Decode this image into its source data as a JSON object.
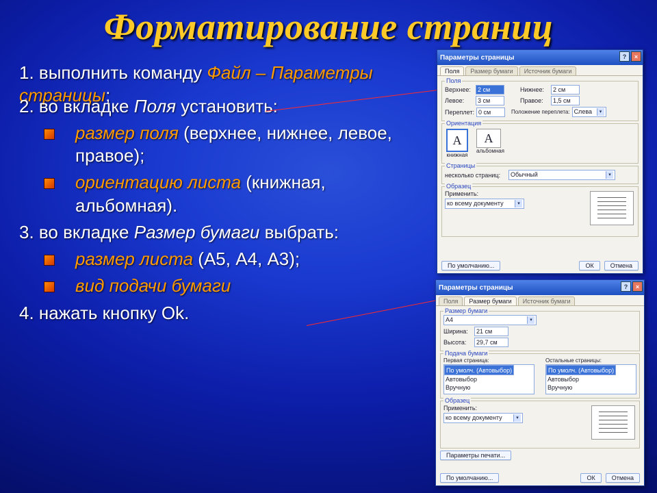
{
  "title": "Форматирование страниц",
  "steps": {
    "s1_a": "1. выполнить команду ",
    "s1_b": "Файл – Параметры страницы",
    "s1_c": ";",
    "s2_a": "2. во вкладке ",
    "s2_b": "Поля",
    "s2_c": " установить:",
    "b1_a": "размер поля",
    "b1_b": " (верхнее, нижнее, левое, правое);",
    "b2_a": "ориентацию листа",
    "b2_b": " (книжная, альбомная).",
    "s3_a": "3. во вкладке ",
    "s3_b": "Размер бумаги",
    "s3_c": " выбрать:",
    "b3_a": "размер листа",
    "b3_b": " (А5, А4, А3);",
    "b4_a": "вид подачи бумаги",
    "s4": "4. нажать  кнопку  Ok."
  },
  "dialog1": {
    "title": "Параметры страницы",
    "tabs": [
      "Поля",
      "Размер бумаги",
      "Источник бумаги"
    ],
    "grp_margins": "Поля",
    "top_l": "Верхнее:",
    "top_v": "2 см",
    "bot_l": "Нижнее:",
    "bot_v": "2 см",
    "left_l": "Левое:",
    "left_v": "3 см",
    "right_l": "Правое:",
    "right_v": "1,5 см",
    "gut_l": "Переплет:",
    "gut_v": "0 см",
    "gutpos_l": "Положение переплета:",
    "gutpos_v": "Слева",
    "grp_orient": "Ориентация",
    "orient_port": "книжная",
    "orient_land": "альбомная",
    "grp_pages": "Страницы",
    "pages_l": "несколько страниц:",
    "pages_v": "Обычный",
    "grp_sample": "Образец",
    "apply_l": "Применить:",
    "apply_v": "ко всему документу",
    "btn_default": "По умолчанию...",
    "btn_ok": "ОК",
    "btn_cancel": "Отмена"
  },
  "dialog2": {
    "title": "Параметры страницы",
    "tabs": [
      "Поля",
      "Размер бумаги",
      "Источник бумаги"
    ],
    "grp_size": "Размер бумаги",
    "size_v": "A4",
    "width_l": "Ширина:",
    "width_v": "21 см",
    "height_l": "Высота:",
    "height_v": "29,7 см",
    "grp_feed": "Подача бумаги",
    "first_l": "Первая страница:",
    "other_l": "Остальные страницы:",
    "feed_opts": [
      "По умолч. (Автовыбор)",
      "Автовыбор",
      "Вручную"
    ],
    "grp_sample": "Образец",
    "apply_l": "Применить:",
    "apply_v": "ко всему документу",
    "btn_print": "Параметры печати...",
    "btn_default": "По умолчанию...",
    "btn_ok": "ОК",
    "btn_cancel": "Отмена"
  }
}
